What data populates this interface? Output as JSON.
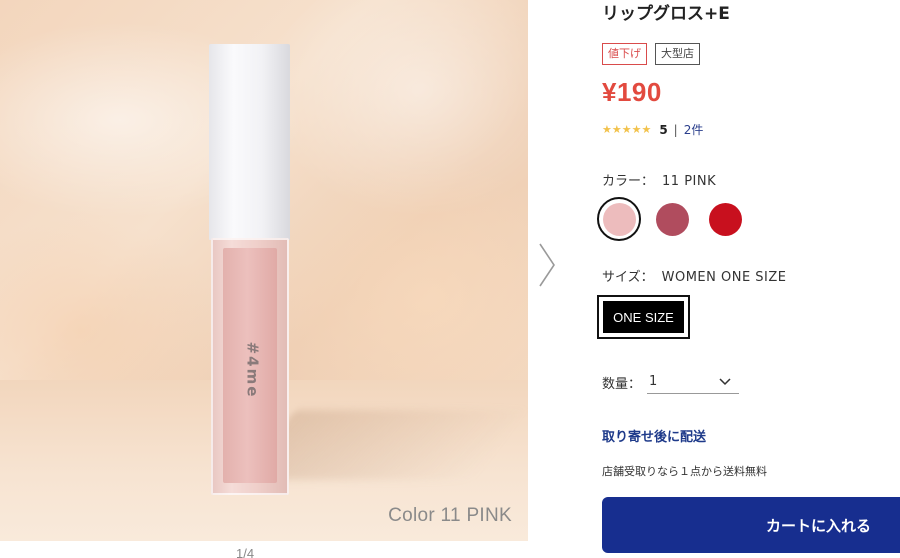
{
  "product": {
    "title": "リップグロス+E",
    "tags": [
      "値下げ",
      "大型店"
    ],
    "price": "¥190",
    "rating": {
      "stars": "★★★★★",
      "score": "5",
      "separator": "|",
      "count": "2件"
    }
  },
  "image": {
    "logo_text": "#4me",
    "caption": "Color 11 PINK",
    "pager": "1/4"
  },
  "options": {
    "color_label": "カラー：",
    "color_value": "11 PINK",
    "swatches": [
      {
        "name": "11 PINK",
        "color": "#edbcbd",
        "selected": true
      },
      {
        "color": "#b04c5e"
      },
      {
        "color": "#c8101e"
      }
    ],
    "size_label": "サイズ：",
    "size_value": "WOMEN ONE SIZE",
    "size_option": "ONE SIZE",
    "quantity_label": "数量：",
    "quantity_value": "1"
  },
  "delivery": {
    "title": "取り寄せ後に配送",
    "shipping_note": "店舗受取りなら１点から送料無料"
  },
  "cart": {
    "button_label": "カートに入れる"
  },
  "colors": {
    "price": "#e24a3f",
    "accent_blue": "#172e8f",
    "sale_tag": "#d94b4b",
    "star": "#f2c24b"
  }
}
